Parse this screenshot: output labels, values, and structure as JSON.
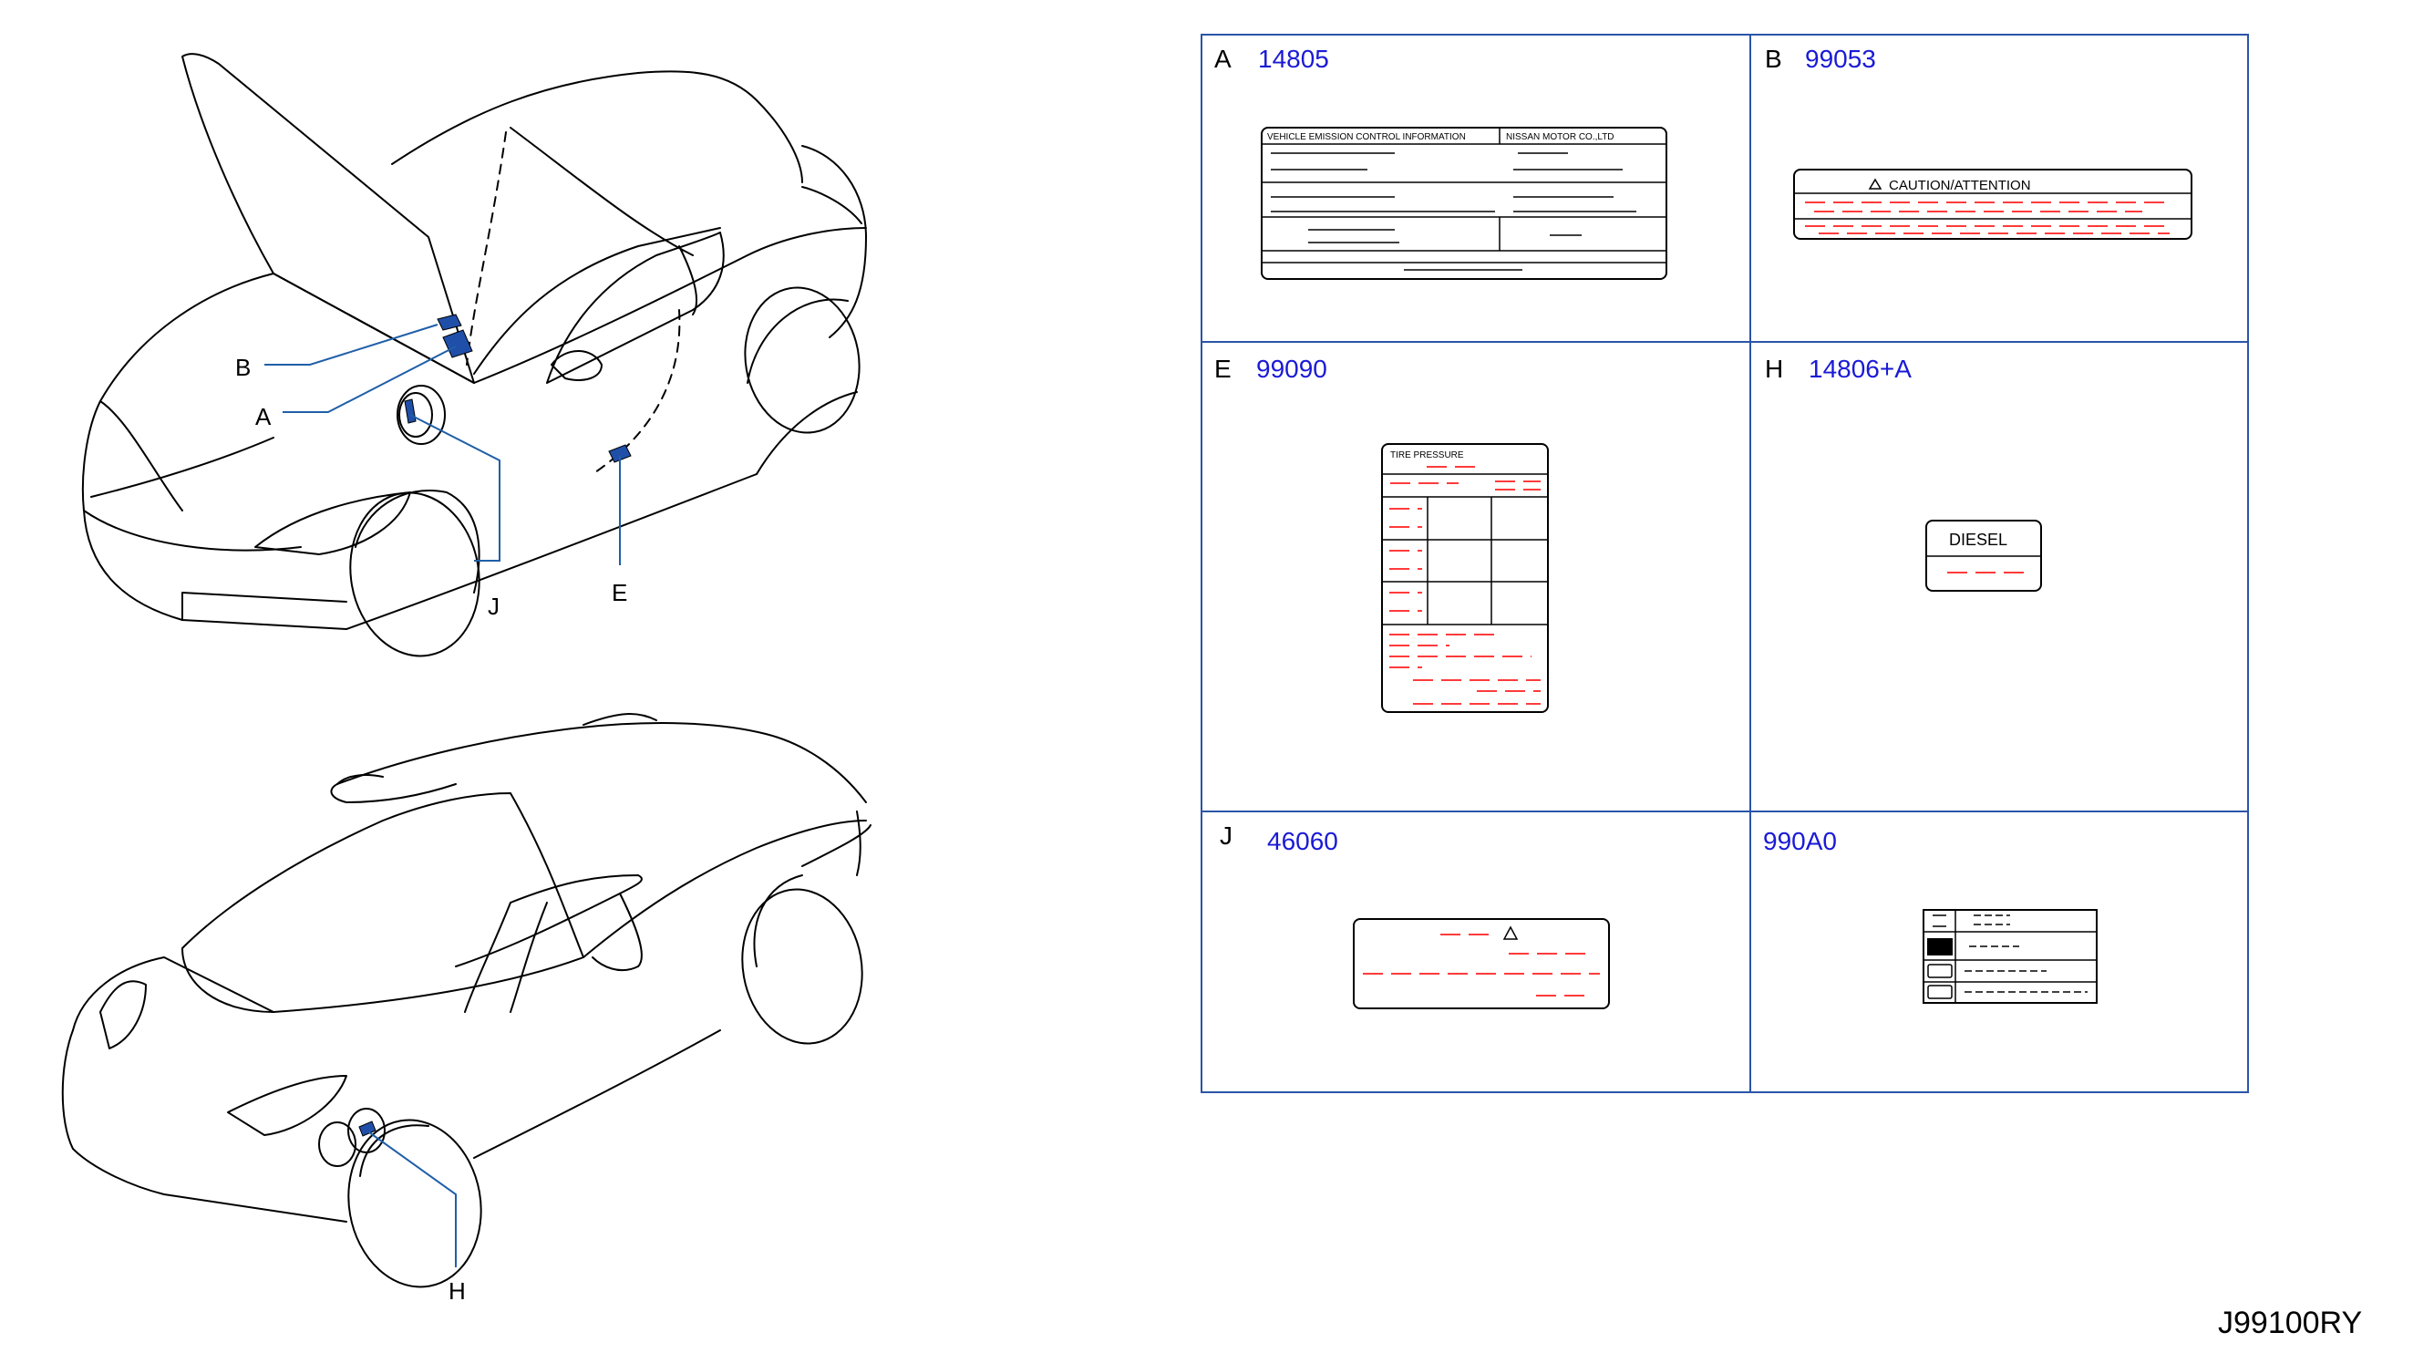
{
  "top_callouts": {
    "b": "B",
    "a": "A",
    "j": "J",
    "e": "E"
  },
  "bottom_callouts": {
    "h": "H"
  },
  "label_table": [
    {
      "letter": "A",
      "part": "14805"
    },
    {
      "letter": "B",
      "part": "99053"
    },
    {
      "letter": "E",
      "part": "99090"
    },
    {
      "letter": "H",
      "part": "14806+A"
    },
    {
      "letter": "J",
      "part": "46060"
    },
    {
      "letter": "",
      "part": "990A0"
    }
  ],
  "emission_label": {
    "left_heading": "VEHICLE    EMISSION    CONTROL    INFORMATION",
    "right_heading": "NISSAN    MOTOR    CO.,LTD"
  },
  "caution_label": {
    "text": "CAUTION/ATTENTION"
  },
  "tire_label": {
    "heading": "TIRE      PRESSURE"
  },
  "fuel_label": {
    "text": "DIESEL"
  },
  "warning_label": {
    "icon": "warning-triangle-icon"
  },
  "reference_code": "J99100RY",
  "colors": {
    "callout_line": "#1f5fa8",
    "sticker_fill": "#1f4fa8",
    "table_border": "#2a55a8",
    "part_number": "#1a1ad6",
    "placeholder_text": "#ff3b3b"
  }
}
